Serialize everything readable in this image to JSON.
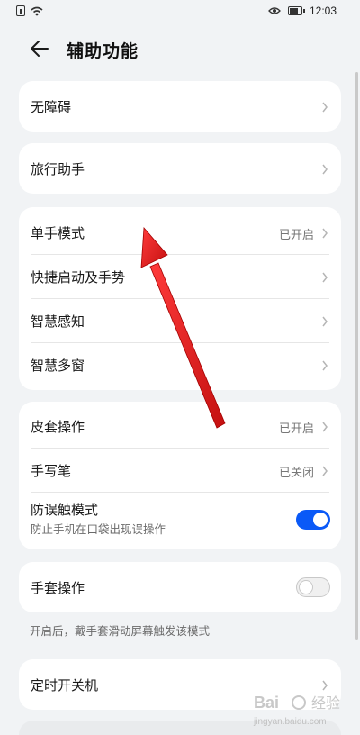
{
  "status_bar": {
    "time": "12:03",
    "battery_level": 0.85,
    "icons": [
      "sim-icon",
      "wifi-icon",
      "eye-icon",
      "battery-icon"
    ]
  },
  "header": {
    "title": "辅助功能",
    "back_icon": "back-arrow-icon"
  },
  "cards": {
    "no_barrier": {
      "label": "无障碍"
    },
    "travel_assistant": {
      "label": "旅行助手"
    },
    "group1": {
      "one_hand_mode": {
        "label": "单手模式",
        "value": "已开启"
      },
      "shortcut_gestures": {
        "label": "快捷启动及手势"
      },
      "smart_sensing": {
        "label": "智慧感知"
      },
      "smart_multiwindow": {
        "label": "智慧多窗"
      }
    },
    "group2": {
      "cover_operation": {
        "label": "皮套操作",
        "value": "已开启"
      },
      "stylus": {
        "label": "手写笔",
        "value": "已关闭"
      },
      "pocket_mode": {
        "label": "防误触模式",
        "sublabel": "防止手机在口袋出现误操作",
        "enabled": true
      }
    },
    "glove_mode": {
      "label": "手套操作",
      "enabled": false
    },
    "glove_note": "开启后，戴手套滑动屏幕触发该模式",
    "scheduled_power": {
      "label": "定时开关机"
    }
  },
  "annotation": {
    "arrow_color": "#e02020"
  },
  "colors": {
    "accent": "#0a59f7",
    "background": "#f1f3f5",
    "card": "#ffffff"
  }
}
